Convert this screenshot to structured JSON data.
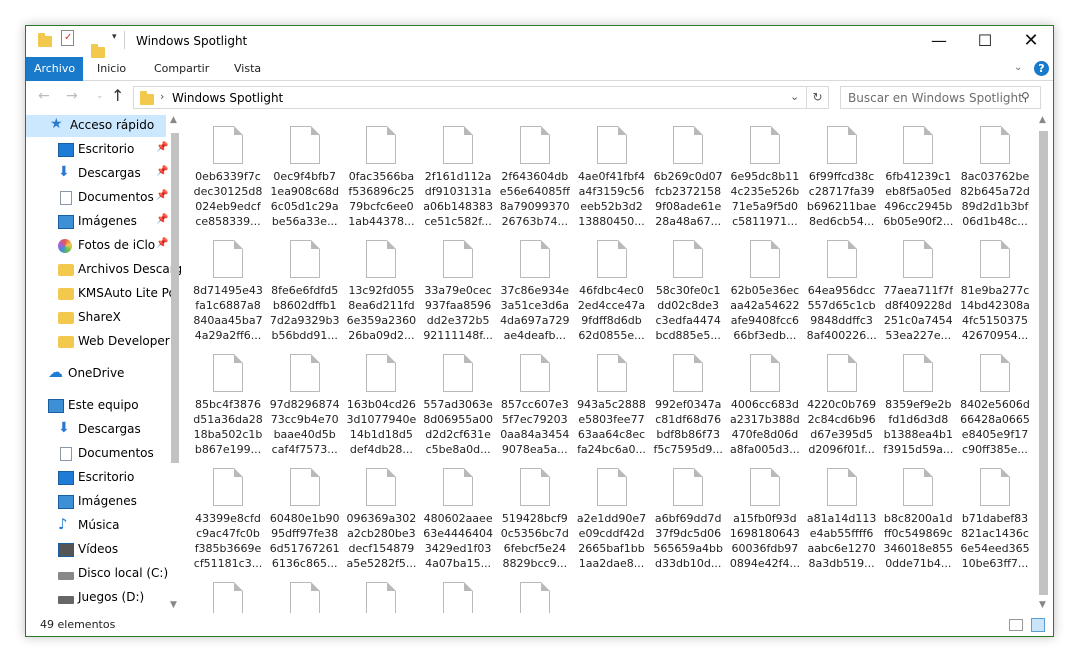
{
  "window": {
    "title": "Windows Spotlight"
  },
  "ribbon": {
    "tabs": [
      "Archivo",
      "Inicio",
      "Compartir",
      "Vista"
    ]
  },
  "address": {
    "path": "Windows Spotlight",
    "search_placeholder": "Buscar en Windows Spotlight"
  },
  "nav": {
    "items": [
      {
        "label": "Acceso rápido",
        "icon": "star-icon",
        "color": "#2b78d0"
      },
      {
        "label": "Escritorio",
        "icon": "desktop-icon",
        "color": "#1e7bd6"
      },
      {
        "label": "Descargas",
        "icon": "download-arrow-icon",
        "color": "#2b78d0"
      },
      {
        "label": "Documentos",
        "icon": "document-icon",
        "color": "#8a99a8"
      },
      {
        "label": "Imágenes",
        "icon": "pictures-icon",
        "color": "#3d8fd6"
      },
      {
        "label": "Fotos de iClo",
        "icon": "photos-icon",
        "color": "#e2584c"
      },
      {
        "label": "Archivos Descarg",
        "icon": "folder-icon",
        "color": "#f2c94c"
      },
      {
        "label": "KMSAuto Lite Po",
        "icon": "folder-icon",
        "color": "#f2c94c"
      },
      {
        "label": "ShareX",
        "icon": "folder-icon",
        "color": "#f2c94c"
      },
      {
        "label": "Web Developer I",
        "icon": "folder-icon",
        "color": "#f2c94c"
      },
      {
        "label": "OneDrive",
        "icon": "cloud-icon",
        "color": "#1e7bd6"
      },
      {
        "label": "Este equipo",
        "icon": "computer-icon",
        "color": "#3d8fd6"
      },
      {
        "label": "Descargas",
        "icon": "download-arrow-icon",
        "color": "#2b78d0"
      },
      {
        "label": "Documentos",
        "icon": "document-icon",
        "color": "#8a99a8"
      },
      {
        "label": "Escritorio",
        "icon": "desktop-icon",
        "color": "#1e7bd6"
      },
      {
        "label": "Imágenes",
        "icon": "pictures-icon",
        "color": "#3d8fd6"
      },
      {
        "label": "Música",
        "icon": "music-icon",
        "color": "#1e7bd6"
      },
      {
        "label": "Vídeos",
        "icon": "video-icon",
        "color": "#555555"
      },
      {
        "label": "Disco local (C:)",
        "icon": "drive-icon",
        "color": "#888888"
      },
      {
        "label": "Juegos (D:)",
        "icon": "drive-icon",
        "color": "#666666"
      }
    ]
  },
  "files": [
    "0eb6339f7c\ndec30125d8\n024eb9edcf\nce858339...",
    "0ec9f4bfb7\n1ea908c68d\n6c05d1c29a\nbe56a33e...",
    "0fac3566ba\nf536896c25\n79bcfc6ee0\n1ab44378...",
    "2f161d112a\ndf9103131a\na06b148383\nce51c582f...",
    "2f643604db\ne56e64085ff\n8a79099370\n26763b74...",
    "4ae0f41fbf4\na4f3159c56\neeb52b3d2\n13880450...",
    "6b269c0d07\nfcb2372158\n9f08ade61e\n28a48a67...",
    "6e95dc8b11\n4c235e526b\n71e5a9f5d0\nc5811971...",
    "6f99ffcd38c\nc28717fa39\nb696211bae\n8ed6cb54...",
    "6fb41239c1\neb8f5a05ed\n496cc2945b\n6b05e90f2...",
    "8ac03762be\n82b645a72d\n89d2d1b3bf\n06d1b48c...",
    "8d71495e43\nfa1c6887a8\n840aa45ba7\n4a29a2ff6...",
    "8fe6e6fdfd5\nb8602dffb1\n7d2a9329b3\nb56bdd91...",
    "13c92fd055\n8ea6d211fd\n6e359a2360\n26ba09d2...",
    "33a79e0cec\n937faa8596\ndd2e372b5\n92111148f...",
    "37c86e934e\n3a51ce3d6a\n4da697a729\nae4deafb...",
    "46fdbc4ec0\n2ed4cce47a\n9fdff8d6db\n62d0855e...",
    "58c30fe0c1\ndd02c8de3\nc3edfa4474\nbcd885e5...",
    "62b05e36ec\naa42a54622\nafe9408fcc6\n66bf3edb...",
    "64ea956dcc\n557d65c1cb\n9848ddffc3\n8af400226...",
    "77aea711f7f\nd8f409228d\n251c0a7454\n53ea227e...",
    "81e9ba277c\n14bd42308a\n4fc5150375\n42670954...",
    "85bc4f3876\nd51a36da28\n18ba502c1b\nb867e199...",
    "97d8296874\n73cc9b4e70\nbaae40d5b\ncaf4f7573...",
    "163b04cd26\n3d1077940e\n14b1d18d5\ndef4db28...",
    "557ad3063e\n8d06955a00\nd2d2cf631e\nc5be8a0d...",
    "857cc607e3\n5f7ec79203\n0aa84a3454\n9078ea5a...",
    "943a5c2888\ne5803fee77\n63aa64c8ec\nfa24bc6a0...",
    "992ef0347a\nc81df68d76\nbdf8b86f73\nf5c7595d9...",
    "4006cc683d\na2317b388d\n470fe8d06d\na8fa005d3...",
    "4220c0b769\n2c84cd6b96\nd67e395d5\nd2096f01f...",
    "8359ef9e2b\nfd1d6d3d8\nb1388ea4b1\nf3915d59a...",
    "8402e5606d\n66428a0665\ne8405e9f17\nc90ff385e...",
    "43399e8cfd\nc9ac47fc0b\nf385b3669e\ncf51181c3...",
    "60480e1b90\n95dff97fe38\n6d51767261\n6136c865...",
    "096369a302\na2cb280be3\ndecf154879\na5e5282f5...",
    "480602aaee\n63e4446404\n3429ed1f03\n4a07ba15...",
    "519428bcf9\n0c5356bc7d\n6febcf5e24\n8829bcc9...",
    "a2e1dd90e7\ne09cddf42d\n2665baf1bb\n1aa2dae8...",
    "a6bf69dd7d\n37f9dc5d06\n565659a4bb\nd33db10d...",
    "a15fb0f93d\n1698180643\n60036fdb97\n0894e42f4...",
    "a81a14d113\ne4ab55ffff6\naabc6e1270\n8a3db519...",
    "b8c8200a1d\nff0c549869c\n346018e855\n0dde71b4...",
    "b71dabef83\n821ac1436c\n6e54eed365\n10be63ff7...",
    "",
    "",
    "",
    "",
    ""
  ],
  "status": {
    "count": "49 elementos"
  }
}
